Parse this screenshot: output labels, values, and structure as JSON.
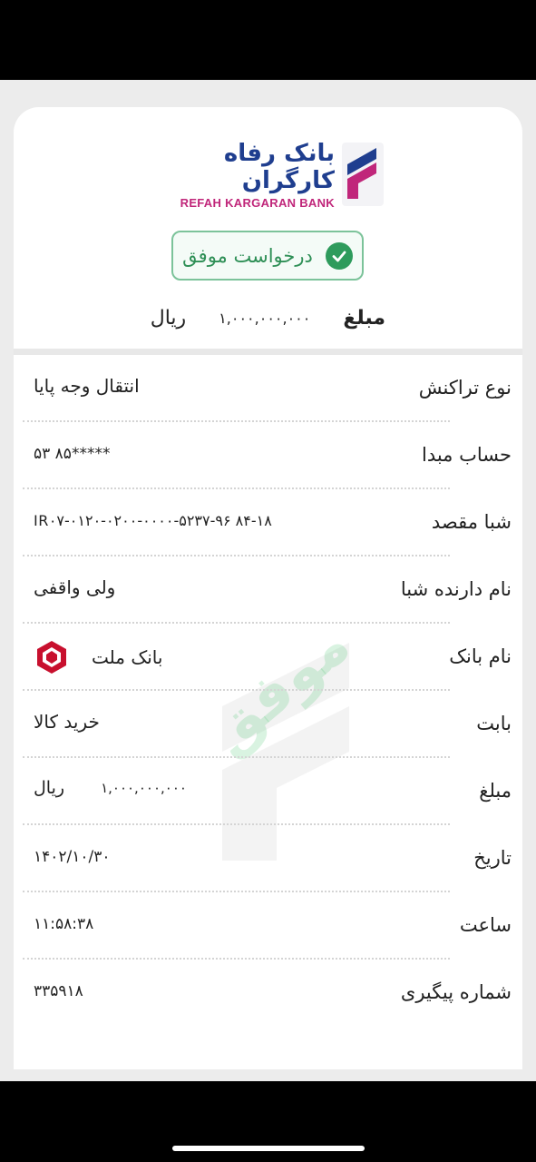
{
  "bank": {
    "name_fa": "بانک رفاه کارگران",
    "name_en": "REFAH KARGARAN BANK",
    "brand_color": "#1f3e8f",
    "accent_color": "#c0267a",
    "logo_icon": "refah-bank-logo-icon"
  },
  "status": {
    "label": "درخواست موفق",
    "icon": "check-circle-icon",
    "color": "#2e9b5c"
  },
  "summary": {
    "amount_label": "مبلغ",
    "amount_value": "۱,۰۰۰,۰۰۰,۰۰۰",
    "currency": "ریال"
  },
  "watermark": "موفق",
  "rows": [
    {
      "key": "نوع تراکنش",
      "value": "انتقال وجه پایا"
    },
    {
      "key": "حساب مبدا",
      "value": "*****۸۵ ۵۳"
    },
    {
      "key": "شبا مقصد",
      "value": "IR۰۷-۰۱۲۰-۰۲۰۰-۰۰۰۰-۵۲۳۷-۹۶ ۸۴-۱۸"
    },
    {
      "key": "نام دارنده شبا",
      "value": "ولی واقفی"
    },
    {
      "key": "نام بانک",
      "value": "بانک ملت",
      "icon": "mellat-bank-icon"
    },
    {
      "key": "بابت",
      "value": "خرید کالا"
    },
    {
      "key": "مبلغ",
      "value": "۱,۰۰۰,۰۰۰,۰۰۰",
      "currency": "ریال"
    },
    {
      "key": "تاریخ",
      "value": "۱۴۰۲/۱۰/۳۰"
    },
    {
      "key": "ساعت",
      "value": "۱۱:۵۸:۳۸"
    },
    {
      "key": "شماره پیگیری",
      "value": "۳۳۵۹۱۸"
    }
  ]
}
